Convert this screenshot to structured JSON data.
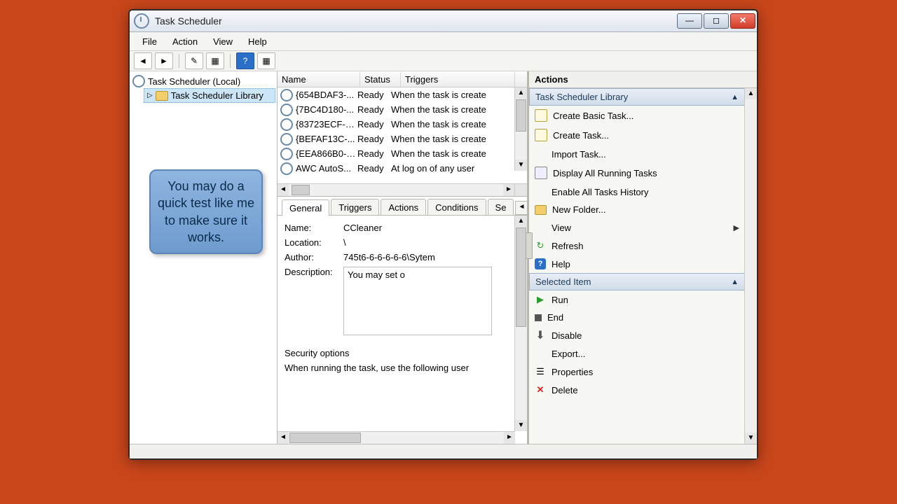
{
  "window": {
    "title": "Task Scheduler"
  },
  "menu": {
    "file": "File",
    "action": "Action",
    "view": "View",
    "help": "Help"
  },
  "tree": {
    "root": "Task Scheduler (Local)",
    "library": "Task Scheduler Library"
  },
  "callout": "You may do a quick test like me to make sure it works.",
  "columns": {
    "name": "Name",
    "status": "Status",
    "triggers": "Triggers"
  },
  "tasks": [
    {
      "name": "{654BDAF3-...",
      "status": "Ready",
      "trigger": "When the task is create"
    },
    {
      "name": "{7BC4D180-...",
      "status": "Ready",
      "trigger": "When the task is create"
    },
    {
      "name": "{83723ECF-5...",
      "status": "Ready",
      "trigger": "When the task is create"
    },
    {
      "name": "{BEFAF13C-...",
      "status": "Ready",
      "trigger": "When the task is create"
    },
    {
      "name": "{EEA866B0-1...",
      "status": "Ready",
      "trigger": "When the task is create"
    },
    {
      "name": "AWC AutoS...",
      "status": "Ready",
      "trigger": "At log on of any user"
    }
  ],
  "tabs": {
    "general": "General",
    "triggers": "Triggers",
    "actions": "Actions",
    "conditions": "Conditions",
    "settings": "Se"
  },
  "detail": {
    "name_label": "Name:",
    "name_value": "CCleaner",
    "location_label": "Location:",
    "location_value": "\\",
    "author_label": "Author:",
    "author_value": "745t6-6-6-6-6-6\\Sytem",
    "desc_label": "Description:",
    "desc_value": "You may set o",
    "security_title": "Security options",
    "security_line": "When running the task, use the following user"
  },
  "actions": {
    "header": "Actions",
    "library_section": "Task Scheduler Library",
    "create_basic": "Create Basic Task...",
    "create_task": "Create Task...",
    "import_task": "Import Task...",
    "display_running": "Display All Running Tasks",
    "enable_history": "Enable All Tasks History",
    "new_folder": "New Folder...",
    "view": "View",
    "refresh": "Refresh",
    "help": "Help",
    "selected_section": "Selected Item",
    "run": "Run",
    "end": "End",
    "disable": "Disable",
    "export": "Export...",
    "properties": "Properties",
    "delete": "Delete"
  }
}
